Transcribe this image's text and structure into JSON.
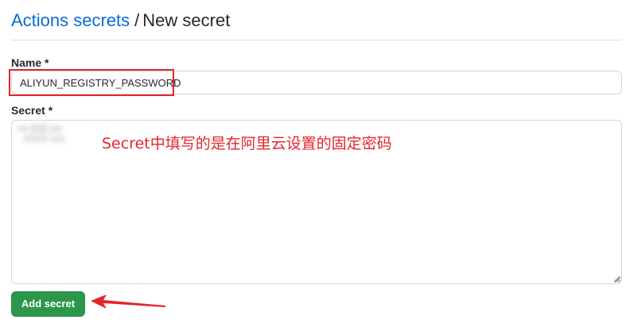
{
  "header": {
    "breadcrumb_link": "Actions secrets",
    "separator": "/",
    "current": "New secret"
  },
  "form": {
    "name_label": "Name *",
    "name_value": "ALIYUN_REGISTRY_PASSWORD",
    "secret_label": "Secret *",
    "submit_label": "Add secret"
  },
  "annotation": {
    "note": "Secret中填写的是在阿里云设置的固定密码",
    "color": "#e3262b"
  },
  "colors": {
    "link": "#0969da",
    "button": "#2c974b",
    "highlight": "#e3262b"
  }
}
